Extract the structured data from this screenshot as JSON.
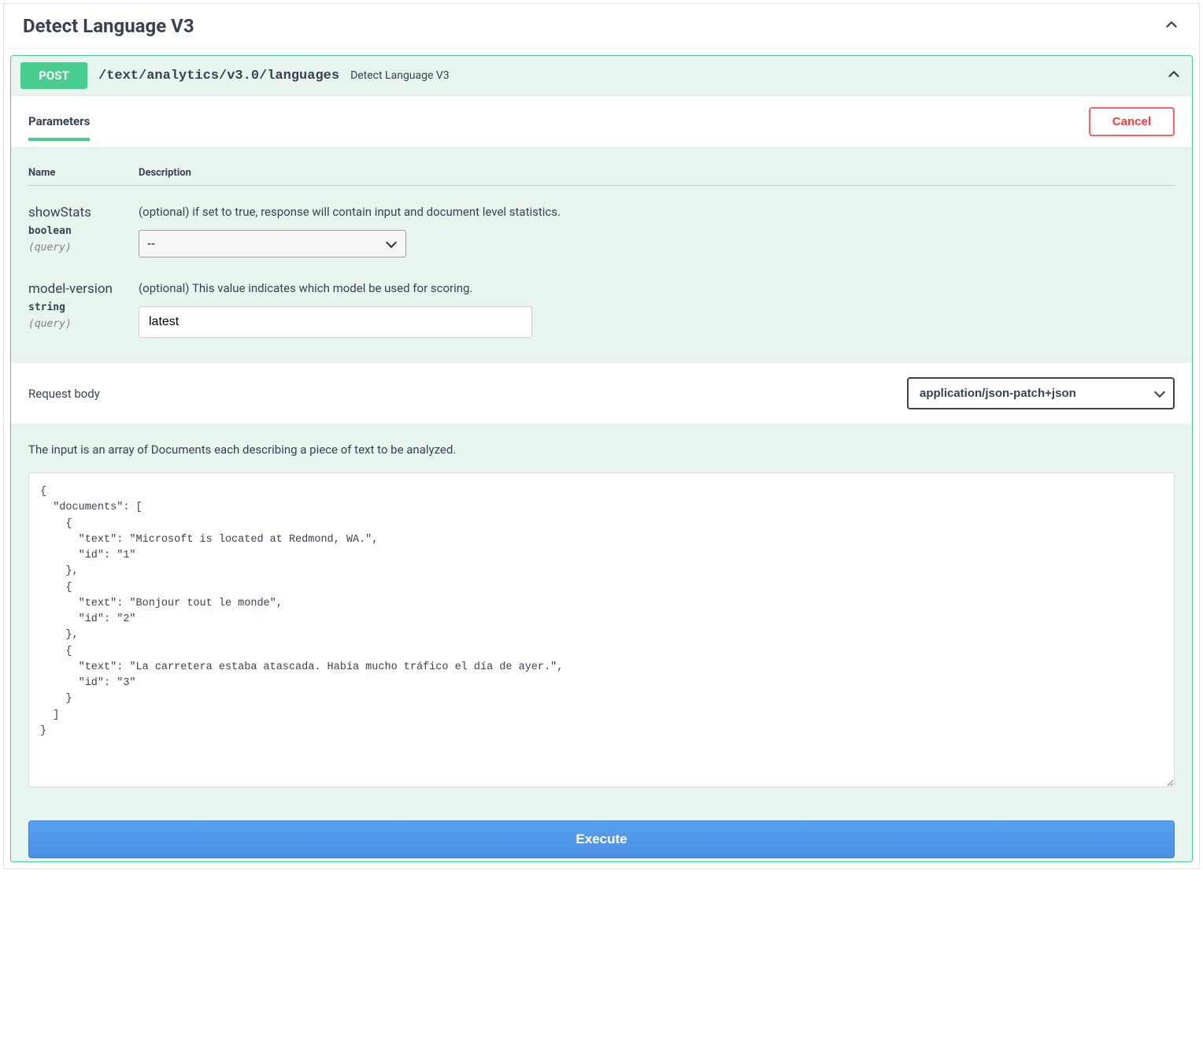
{
  "section": {
    "title": "Detect Language V3"
  },
  "endpoint": {
    "method": "POST",
    "path": "/text/analytics/v3.0/languages",
    "summary": "Detect Language V3"
  },
  "tabs": {
    "parameters": "Parameters",
    "cancel": "Cancel"
  },
  "columns": {
    "name": "Name",
    "description": "Description"
  },
  "params": [
    {
      "name": "showStats",
      "type": "boolean",
      "loc": "(query)",
      "desc": "(optional) if set to true, response will contain input and document level statistics.",
      "control": "select",
      "value": "--"
    },
    {
      "name": "model-version",
      "type": "string",
      "loc": "(query)",
      "desc": "(optional) This value indicates which model be used for scoring.",
      "control": "text",
      "value": "latest"
    }
  ],
  "requestBody": {
    "label": "Request body",
    "contentType": "application/json-patch+json",
    "desc": "The input is an array of Documents each describing a piece of text to be analyzed.",
    "body": "{\n  \"documents\": [\n    {\n      \"text\": \"Microsoft is located at Redmond, WA.\",\n      \"id\": \"1\"\n    },\n    {\n      \"text\": \"Bonjour tout le monde\",\n      \"id\": \"2\"\n    },\n    {\n      \"text\": \"La carretera estaba atascada. Había mucho tráfico el día de ayer.\",\n      \"id\": \"3\"\n    }\n  ]\n}"
  },
  "execute": {
    "label": "Execute"
  }
}
